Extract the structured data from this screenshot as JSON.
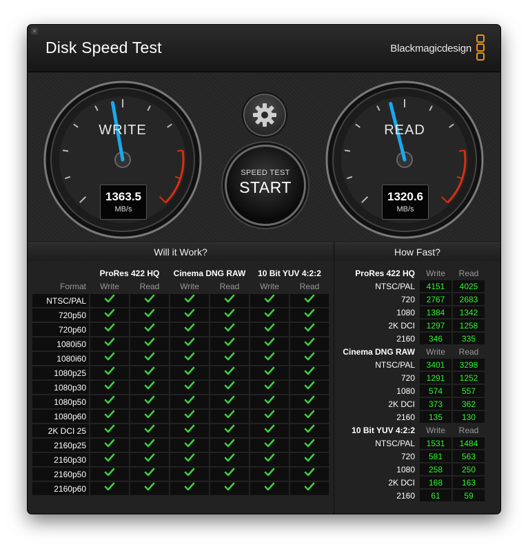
{
  "window": {
    "title": "Disk Speed Test",
    "brand": "Blackmagicdesign"
  },
  "gauges": {
    "write": {
      "label": "WRITE",
      "value": "1363.5",
      "unit": "MB/s"
    },
    "read": {
      "label": "READ",
      "value": "1320.6",
      "unit": "MB/s"
    }
  },
  "start_button": {
    "line1": "SPEED TEST",
    "line2": "START"
  },
  "will_it_work": {
    "title": "Will it Work?",
    "format_header": "Format",
    "groups": [
      "ProRes 422 HQ",
      "Cinema DNG RAW",
      "10 Bit YUV 4:2:2"
    ],
    "subheaders": [
      "Write",
      "Read"
    ],
    "formats": [
      "NTSC/PAL",
      "720p50",
      "720p60",
      "1080i50",
      "1080i60",
      "1080p25",
      "1080p30",
      "1080p50",
      "1080p60",
      "2K DCI 25",
      "2160p25",
      "2160p30",
      "2160p50",
      "2160p60"
    ]
  },
  "how_fast": {
    "title": "How Fast?",
    "write_label": "Write",
    "read_label": "Read",
    "groups": [
      {
        "name": "ProRes 422 HQ",
        "rows": [
          {
            "format": "NTSC/PAL",
            "write": "4151",
            "read": "4025"
          },
          {
            "format": "720",
            "write": "2767",
            "read": "2683"
          },
          {
            "format": "1080",
            "write": "1384",
            "read": "1342"
          },
          {
            "format": "2K DCI",
            "write": "1297",
            "read": "1258"
          },
          {
            "format": "2160",
            "write": "346",
            "read": "335"
          }
        ]
      },
      {
        "name": "Cinema DNG RAW",
        "rows": [
          {
            "format": "NTSC/PAL",
            "write": "3401",
            "read": "3298"
          },
          {
            "format": "720",
            "write": "1291",
            "read": "1252"
          },
          {
            "format": "1080",
            "write": "574",
            "read": "557"
          },
          {
            "format": "2K DCI",
            "write": "373",
            "read": "362"
          },
          {
            "format": "2160",
            "write": "135",
            "read": "130"
          }
        ]
      },
      {
        "name": "10 Bit YUV 4:2:2",
        "rows": [
          {
            "format": "NTSC/PAL",
            "write": "1531",
            "read": "1484"
          },
          {
            "format": "720",
            "write": "581",
            "read": "563"
          },
          {
            "format": "1080",
            "write": "258",
            "read": "250"
          },
          {
            "format": "2K DCI",
            "write": "168",
            "read": "163"
          },
          {
            "format": "2160",
            "write": "61",
            "read": "59"
          }
        ]
      }
    ]
  },
  "colors": {
    "accent": "#e8961e",
    "needle": "#19a9f0",
    "value_green": "#2bf52b",
    "check_green": "#3fcf3f",
    "redline": "#d83010"
  }
}
